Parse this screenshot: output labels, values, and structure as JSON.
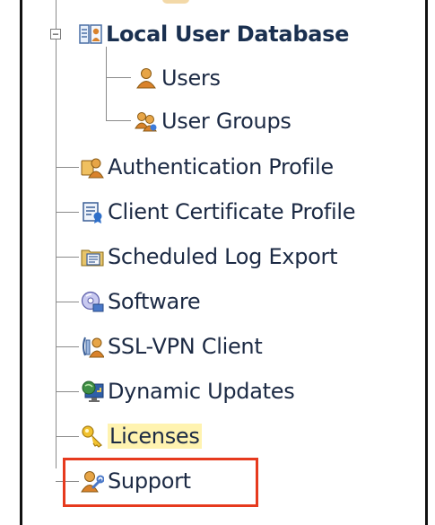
{
  "tree": {
    "root": {
      "label": "Local User Database",
      "icon": "local-user-database-icon",
      "expanded": true
    },
    "children": [
      {
        "label": "Users",
        "icon": "user-icon"
      },
      {
        "label": "User Groups",
        "icon": "user-groups-icon"
      }
    ],
    "items": [
      {
        "label": "Authentication Profile",
        "icon": "authentication-profile-icon"
      },
      {
        "label": "Client Certificate Profile",
        "icon": "client-certificate-icon"
      },
      {
        "label": "Scheduled Log Export",
        "icon": "scheduled-log-export-icon"
      },
      {
        "label": "Software",
        "icon": "software-icon"
      },
      {
        "label": "SSL-VPN Client",
        "icon": "ssl-vpn-client-icon"
      },
      {
        "label": "Dynamic Updates",
        "icon": "dynamic-updates-icon"
      },
      {
        "label": "Licenses",
        "icon": "key-icon"
      },
      {
        "label": "Support",
        "icon": "support-icon"
      }
    ]
  },
  "expander_symbol": "−",
  "highlight_color": "#e63a1e"
}
